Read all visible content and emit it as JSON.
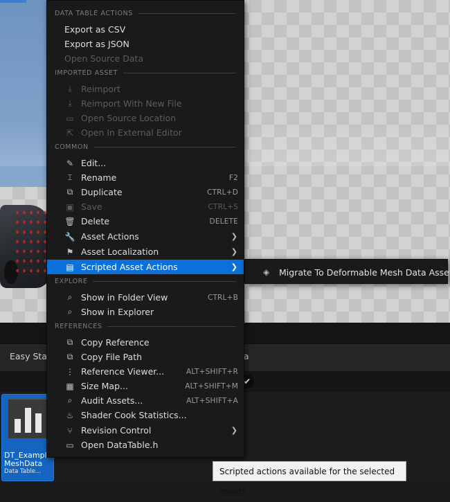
{
  "menu": {
    "sections": {
      "data_table_actions": "DATA TABLE ACTIONS",
      "imported_asset": "IMPORTED ASSET",
      "common": "COMMON",
      "explore": "EXPLORE",
      "references": "REFERENCES"
    },
    "items": {
      "export_csv": {
        "label": "Export as CSV"
      },
      "export_json": {
        "label": "Export as JSON"
      },
      "open_source_data": {
        "label": "Open Source Data"
      },
      "reimport": {
        "label": "Reimport"
      },
      "reimport_new": {
        "label": "Reimport With New File"
      },
      "open_source_location": {
        "label": "Open Source Location"
      },
      "open_external_editor": {
        "label": "Open In External Editor"
      },
      "edit": {
        "label": "Edit..."
      },
      "rename": {
        "label": "Rename",
        "shortcut": "F2"
      },
      "duplicate": {
        "label": "Duplicate",
        "shortcut": "CTRL+D"
      },
      "save": {
        "label": "Save",
        "shortcut": "CTRL+S"
      },
      "delete": {
        "label": "Delete",
        "shortcut": "DELETE"
      },
      "asset_actions": {
        "label": "Asset Actions"
      },
      "asset_localization": {
        "label": "Asset Localization"
      },
      "scripted_asset_actions": {
        "label": "Scripted Asset Actions"
      },
      "show_folder_view": {
        "label": "Show in Folder View",
        "shortcut": "CTRL+B"
      },
      "show_explorer": {
        "label": "Show in Explorer"
      },
      "copy_reference": {
        "label": "Copy Reference"
      },
      "copy_file_path": {
        "label": "Copy File Path"
      },
      "reference_viewer": {
        "label": "Reference Viewer...",
        "shortcut": "ALT+SHIFT+R"
      },
      "size_map": {
        "label": "Size Map...",
        "shortcut": "ALT+SHIFT+M"
      },
      "audit_assets": {
        "label": "Audit Assets...",
        "shortcut": "ALT+SHIFT+A"
      },
      "shader_cook_stats": {
        "label": "Shader Cook Statistics..."
      },
      "revision_control": {
        "label": "Revision Control"
      },
      "open_datatable_h": {
        "label": "Open DataTable.h"
      }
    }
  },
  "submenu": {
    "migrate": "Migrate To Deformable Mesh Data Asset"
  },
  "tooltip": "Scripted actions available for the selected assets",
  "bottom": {
    "tab_easy_stat": "Easy Stat",
    "tab_ta": "ta"
  },
  "asset": {
    "name_line1": "DT_Example",
    "name_line2": "MeshData",
    "type": "Data Table..."
  },
  "colors": {
    "highlight": "#0b70d9",
    "menu_bg": "#1a1a1a",
    "asset_tile": "#1565c0"
  }
}
